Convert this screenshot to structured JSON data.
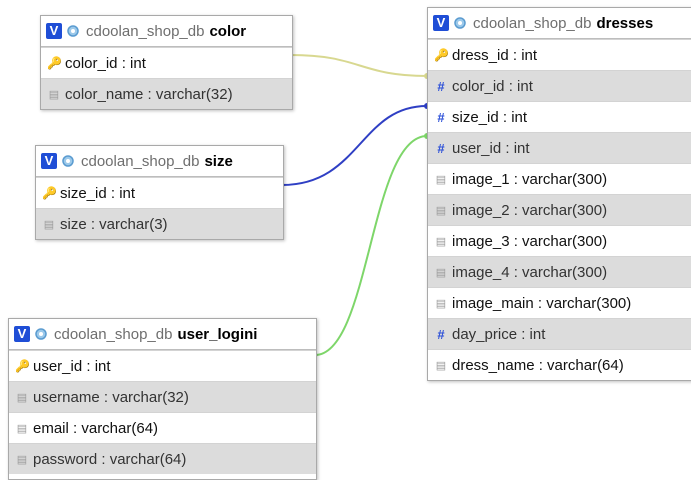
{
  "tables": {
    "color": {
      "db": "cdoolan_shop_db",
      "name": "color",
      "columns": [
        {
          "label": "color_id : int",
          "icon": "key-icon"
        },
        {
          "label": "color_name : varchar(32)",
          "icon": "text-field-icon"
        }
      ]
    },
    "size": {
      "db": "cdoolan_shop_db",
      "name": "size",
      "columns": [
        {
          "label": "size_id : int",
          "icon": "key-icon"
        },
        {
          "label": "size : varchar(3)",
          "icon": "text-field-icon"
        }
      ]
    },
    "user_login": {
      "db": "cdoolan_shop_db",
      "name": "user_logini",
      "columns": [
        {
          "label": "user_id : int",
          "icon": "key-icon"
        },
        {
          "label": "username : varchar(32)",
          "icon": "text-field-icon"
        },
        {
          "label": "email : varchar(64)",
          "icon": "text-field-icon"
        },
        {
          "label": "password : varchar(64)",
          "icon": "text-field-icon"
        }
      ]
    },
    "dresses": {
      "db": "cdoolan_shop_db",
      "name": "dresses",
      "columns": [
        {
          "label": "dress_id : int",
          "icon": "key-icon"
        },
        {
          "label": "color_id : int",
          "icon": "hash-icon"
        },
        {
          "label": "size_id : int",
          "icon": "hash-icon"
        },
        {
          "label": "user_id : int",
          "icon": "hash-icon"
        },
        {
          "label": "image_1 : varchar(300)",
          "icon": "text-field-icon"
        },
        {
          "label": "image_2 : varchar(300)",
          "icon": "text-field-icon"
        },
        {
          "label": "image_3 : varchar(300)",
          "icon": "text-field-icon"
        },
        {
          "label": "image_4 : varchar(300)",
          "icon": "text-field-icon"
        },
        {
          "label": "image_main : varchar(300)",
          "icon": "text-field-icon"
        },
        {
          "label": "day_price : int",
          "icon": "hash-icon"
        },
        {
          "label": "dress_name : varchar(64)",
          "icon": "text-field-icon"
        }
      ]
    }
  },
  "icons": {
    "v_label": "V"
  },
  "colors": {
    "link_color": "#d8d890",
    "link_size": "#2f3fc4",
    "link_user": "#7ed66a",
    "v_button": "#1f4ed6"
  }
}
